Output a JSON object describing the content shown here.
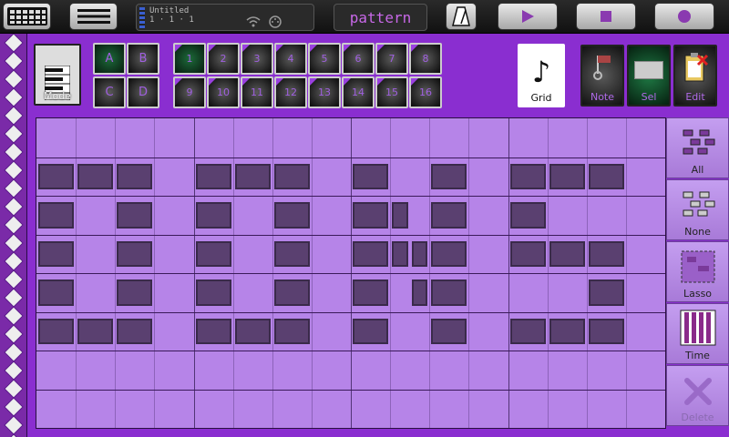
{
  "toolbar": {
    "song_title": "Untitled",
    "position": "1 · 1 · 1",
    "pattern_label": "pattern"
  },
  "sections": [
    {
      "label": "A",
      "active": true
    },
    {
      "label": "B",
      "active": false
    },
    {
      "label": "C",
      "active": false
    },
    {
      "label": "D",
      "active": false
    }
  ],
  "pattern_slots": [
    {
      "label": "1",
      "active": true
    },
    {
      "label": "2",
      "active": false
    },
    {
      "label": "3",
      "active": false
    },
    {
      "label": "4",
      "active": false
    },
    {
      "label": "5",
      "active": false
    },
    {
      "label": "6",
      "active": false
    },
    {
      "label": "7",
      "active": false
    },
    {
      "label": "8",
      "active": false
    },
    {
      "label": "9",
      "active": false
    },
    {
      "label": "10",
      "active": false
    },
    {
      "label": "11",
      "active": false
    },
    {
      "label": "12",
      "active": false
    },
    {
      "label": "13",
      "active": false
    },
    {
      "label": "14",
      "active": false
    },
    {
      "label": "15",
      "active": false
    },
    {
      "label": "16",
      "active": false
    }
  ],
  "mode_label": "Mode",
  "grid_label": "Grid",
  "note_label": "Note",
  "sel_label": "Sel",
  "edit_label": "Edit",
  "side_tools": [
    {
      "label": "All",
      "enabled": true
    },
    {
      "label": "None",
      "enabled": true
    },
    {
      "label": "Lasso",
      "enabled": true
    },
    {
      "label": "Time",
      "enabled": true
    },
    {
      "label": "Delete",
      "enabled": false
    }
  ],
  "sequencer": {
    "steps": 16,
    "rows": 8,
    "notes": [
      {
        "row": 1,
        "step": 1,
        "len": 1
      },
      {
        "row": 1,
        "step": 2,
        "len": 1
      },
      {
        "row": 1,
        "step": 3,
        "len": 1
      },
      {
        "row": 1,
        "step": 5,
        "len": 1
      },
      {
        "row": 1,
        "step": 6,
        "len": 1
      },
      {
        "row": 1,
        "step": 7,
        "len": 1
      },
      {
        "row": 1,
        "step": 9,
        "len": 1
      },
      {
        "row": 1,
        "step": 11,
        "len": 1
      },
      {
        "row": 1,
        "step": 13,
        "len": 1
      },
      {
        "row": 1,
        "step": 14,
        "len": 1
      },
      {
        "row": 1,
        "step": 15,
        "len": 1
      },
      {
        "row": 2,
        "step": 1,
        "len": 1
      },
      {
        "row": 2,
        "step": 3,
        "len": 1
      },
      {
        "row": 2,
        "step": 5,
        "len": 1
      },
      {
        "row": 2,
        "step": 7,
        "len": 1
      },
      {
        "row": 2,
        "step": 9,
        "len": 1
      },
      {
        "row": 2,
        "step": 10,
        "len": 0.5
      },
      {
        "row": 2,
        "step": 11,
        "len": 1
      },
      {
        "row": 2,
        "step": 13,
        "len": 1
      },
      {
        "row": 3,
        "step": 1,
        "len": 1
      },
      {
        "row": 3,
        "step": 3,
        "len": 1
      },
      {
        "row": 3,
        "step": 5,
        "len": 1
      },
      {
        "row": 3,
        "step": 7,
        "len": 1
      },
      {
        "row": 3,
        "step": 9,
        "len": 1
      },
      {
        "row": 3,
        "step": 10,
        "len": 0.5
      },
      {
        "row": 3,
        "step": 10.5,
        "len": 0.5
      },
      {
        "row": 3,
        "step": 11,
        "len": 1
      },
      {
        "row": 3,
        "step": 13,
        "len": 1
      },
      {
        "row": 3,
        "step": 14,
        "len": 1
      },
      {
        "row": 3,
        "step": 15,
        "len": 1
      },
      {
        "row": 4,
        "step": 1,
        "len": 1
      },
      {
        "row": 4,
        "step": 3,
        "len": 1
      },
      {
        "row": 4,
        "step": 5,
        "len": 1
      },
      {
        "row": 4,
        "step": 7,
        "len": 1
      },
      {
        "row": 4,
        "step": 9,
        "len": 1
      },
      {
        "row": 4,
        "step": 10.5,
        "len": 0.5
      },
      {
        "row": 4,
        "step": 11,
        "len": 1
      },
      {
        "row": 4,
        "step": 15,
        "len": 1
      },
      {
        "row": 5,
        "step": 1,
        "len": 1
      },
      {
        "row": 5,
        "step": 2,
        "len": 1
      },
      {
        "row": 5,
        "step": 3,
        "len": 1
      },
      {
        "row": 5,
        "step": 5,
        "len": 1
      },
      {
        "row": 5,
        "step": 6,
        "len": 1
      },
      {
        "row": 5,
        "step": 7,
        "len": 1
      },
      {
        "row": 5,
        "step": 9,
        "len": 1
      },
      {
        "row": 5,
        "step": 11,
        "len": 1
      },
      {
        "row": 5,
        "step": 13,
        "len": 1
      },
      {
        "row": 5,
        "step": 14,
        "len": 1
      },
      {
        "row": 5,
        "step": 15,
        "len": 1
      }
    ]
  }
}
